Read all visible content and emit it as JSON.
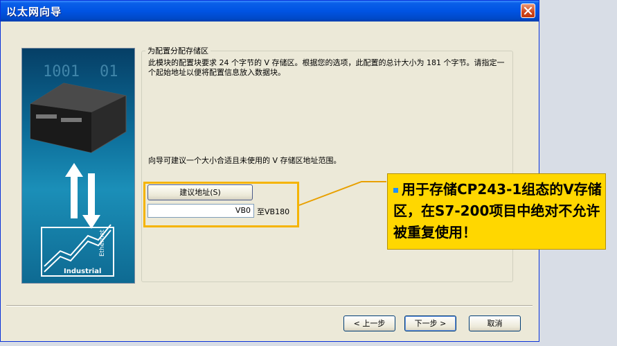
{
  "window": {
    "title": "以太网向导"
  },
  "group": {
    "title": "为配置分配存储区",
    "description": "此模块的配置块要求 24 个字节的 V 存储区。根据您的选项，此配置的总计大小为 181 个字节。请指定一个起始地址以便将配置信息放入数据块。",
    "hint": "向导可建议一个大小合适且未使用的 V 存储区地址范围。"
  },
  "address": {
    "suggest_label": "建议地址(S)",
    "start_value": "VB0",
    "range_end": "至VB180"
  },
  "side_image": {
    "digits_line1": "1001",
    "digits_line2": "01",
    "brand_text": "Industrial",
    "brand_vertical": "Ethernet"
  },
  "buttons": {
    "back": "< 上一步",
    "next": "下一步 >",
    "cancel": "取消"
  },
  "annotation": {
    "text": "用于存储CP243-1组态的V存储区，在S7-200项目中绝对不允许被重复使用！"
  },
  "colors": {
    "title_bar": "#0054e3",
    "highlight": "#f5b400",
    "annotation_bg": "#ffd700",
    "bullet": "#1e90ff"
  }
}
